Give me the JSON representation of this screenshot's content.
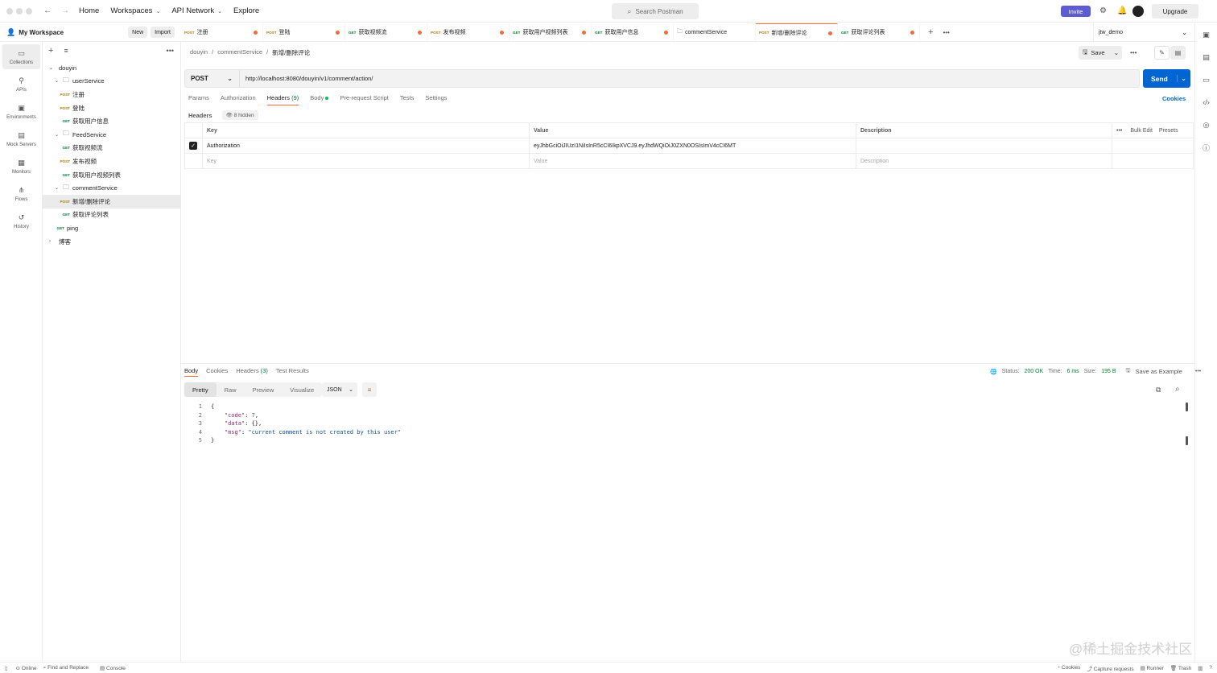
{
  "nav": {
    "home": "Home",
    "workspaces": "Workspaces",
    "api_network": "API Network",
    "explore": "Explore",
    "search_placeholder": "Search Postman",
    "invite": "Invite",
    "upgrade": "Upgrade"
  },
  "workspace": {
    "name": "My Workspace",
    "new": "New",
    "import": "Import"
  },
  "rail": [
    "Collections",
    "APIs",
    "Environments",
    "Mock Servers",
    "Monitors",
    "Flows",
    "History"
  ],
  "tree": {
    "root": "douyin",
    "userService": "userService",
    "u1": "注册",
    "u2": "登陆",
    "u3": "获取用户信息",
    "feedService": "FeedService",
    "f1": "获取视频流",
    "f2": "发布视频",
    "f3": "获取用户视频列表",
    "commentService": "commentService",
    "c1": "新增/删除评论",
    "c2": "获取评论列表",
    "ping": "ping",
    "blog": "博客",
    "post": "POST",
    "get": "GET"
  },
  "tabs": [
    {
      "m": "POST",
      "label": "注册"
    },
    {
      "m": "POST",
      "label": "登陆"
    },
    {
      "m": "GET",
      "label": "获取视频流"
    },
    {
      "m": "POST",
      "label": "发布视频"
    },
    {
      "m": "GET",
      "label": "获取用户视频列表"
    },
    {
      "m": "GET",
      "label": "获取用户信息"
    },
    {
      "m": "",
      "label": "commentService"
    },
    {
      "m": "POST",
      "label": "新增/删除评论"
    },
    {
      "m": "GET",
      "label": "获取评论列表"
    }
  ],
  "env": "jtw_demo",
  "breadcrumb": {
    "a": "douyin",
    "b": "commentService",
    "c": "新增/删除评论",
    "sep": "/"
  },
  "save": "Save",
  "request": {
    "method": "POST",
    "url": "http://localhost:8080/douyin/v1/comment/action/",
    "send": "Send"
  },
  "reqtabs": {
    "params": "Params",
    "auth": "Authorization",
    "headers": "Headers",
    "headers_count": "(9)",
    "body": "Body",
    "prereq": "Pre-request Script",
    "tests": "Tests",
    "settings": "Settings",
    "cookies": "Cookies"
  },
  "headers_sub": {
    "label": "Headers",
    "hidden": "8 hidden"
  },
  "table": {
    "key": "Key",
    "value": "Value",
    "desc": "Description",
    "bulk": "Bulk Edit",
    "presets": "Presets",
    "row_key": "Authorization",
    "row_value": "eyJhbGciOiJIUzI1NiIsInR5cCI6IkpXVCJ9.eyJhdWQiOiJ0ZXN0OSIsImV4cCI6MT",
    "ph_key": "Key",
    "ph_value": "Value",
    "ph_desc": "Description"
  },
  "restabs": {
    "body": "Body",
    "cookies": "Cookies",
    "headers": "Headers",
    "headers_count": "(3)",
    "tests": "Test Results"
  },
  "resmeta": {
    "status_label": "Status:",
    "status": "200 OK",
    "time_label": "Time:",
    "time": "6 ms",
    "size_label": "Size:",
    "size": "195 B",
    "save_example": "Save as Example"
  },
  "fmt": {
    "pretty": "Pretty",
    "raw": "Raw",
    "preview": "Preview",
    "visualize": "Visualize",
    "json": "JSON"
  },
  "code": {
    "l1": "{",
    "k1": "\"code\"",
    "v1": "7",
    "k2": "\"data\"",
    "v2": "{}",
    "k3": "\"msg\"",
    "v3": "\"current comment is not created by this user\"",
    "l5": "}"
  },
  "status": {
    "online": "Online",
    "find": "Find and Replace",
    "console": "Console",
    "cookies": "Cookies",
    "capture": "Capture requests",
    "runner": "Runner",
    "trash": "Trash"
  },
  "watermark": "@稀土掘金技术社区",
  "colors": {
    "accent": "#ff6c37",
    "send": "#0265d2",
    "invite": "#5d5dd1",
    "post": "#ad7a03",
    "get": "#007f31"
  }
}
